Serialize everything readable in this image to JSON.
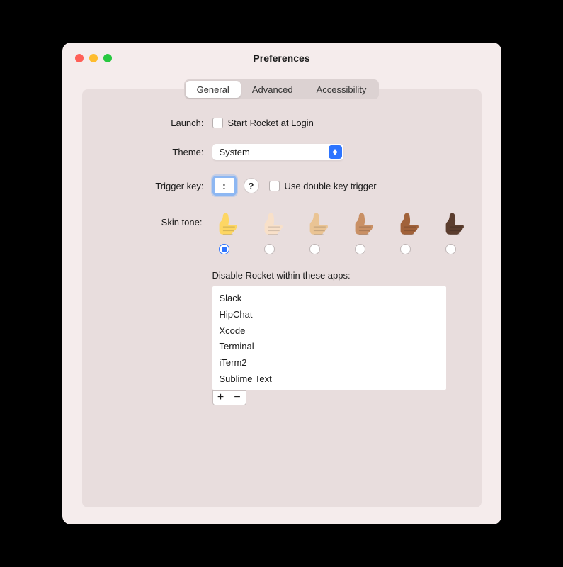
{
  "window": {
    "title": "Preferences"
  },
  "tabs": {
    "items": [
      {
        "label": "General",
        "active": true
      },
      {
        "label": "Advanced",
        "active": false
      },
      {
        "label": "Accessibility",
        "active": false
      }
    ]
  },
  "form": {
    "launch": {
      "label": "Launch:",
      "checkbox_label": "Start Rocket at Login",
      "checked": false
    },
    "theme": {
      "label": "Theme:",
      "selected": "System"
    },
    "trigger": {
      "label": "Trigger key:",
      "value": ":",
      "help": "?",
      "double_label": "Use double key trigger",
      "double_checked": false
    },
    "skin": {
      "label": "Skin tone:",
      "selected_index": 0,
      "tones": [
        "#fdd663",
        "#f8e0c9",
        "#eac494",
        "#c99065",
        "#a1623a",
        "#5b3d2e"
      ]
    },
    "disable": {
      "label": "Disable Rocket within these apps:",
      "apps": [
        "Slack",
        "HipChat",
        "Xcode",
        "Terminal",
        "iTerm2",
        "Sublime Text"
      ],
      "add_icon": "+",
      "remove_icon": "−"
    }
  }
}
